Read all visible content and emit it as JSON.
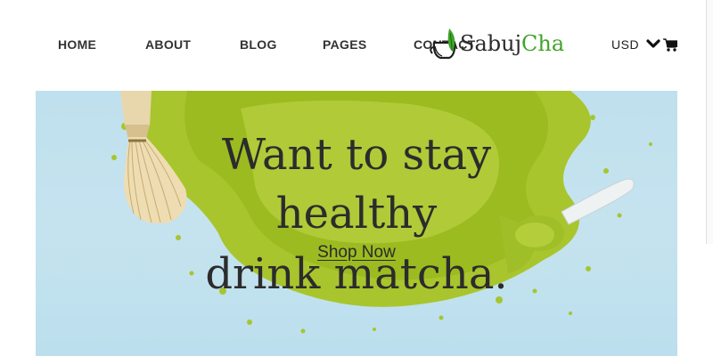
{
  "nav": {
    "items": [
      {
        "label": "HOME"
      },
      {
        "label": "ABOUT"
      },
      {
        "label": "BLOG"
      },
      {
        "label": "PAGES"
      },
      {
        "label": "CONTACT"
      }
    ]
  },
  "logo": {
    "part1": "Sabuj",
    "part2": "Cha"
  },
  "currency": {
    "selected": "USD",
    "icon": "chevron-down-icon"
  },
  "cart": {
    "icon": "shopping-cart-icon"
  },
  "hero": {
    "headline": [
      "Want to stay",
      "healthy",
      "drink matcha."
    ],
    "cta_label": "Shop Now"
  },
  "colors": {
    "brand_green": "#3fa52a",
    "matcha": "#a6c62f",
    "sky": "#c3e2ee",
    "text": "#2c2c2c"
  }
}
